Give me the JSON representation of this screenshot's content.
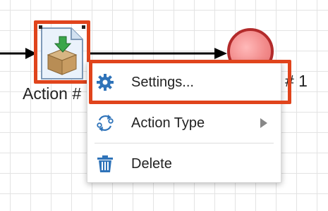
{
  "canvas": {
    "action_node": {
      "label": "Action #",
      "icon": "action-box-icon"
    },
    "end_node": {
      "label": "# 1"
    }
  },
  "context_menu": {
    "items": [
      {
        "label": "Settings...",
        "icon": "gear-icon",
        "highlighted": true
      },
      {
        "label": "Action Type",
        "icon": "action-type-icon",
        "has_submenu": true
      },
      {
        "label": "Delete",
        "icon": "trash-icon"
      }
    ]
  },
  "colors": {
    "highlight": "#e0441c",
    "end_node_fill": "#f28b8b",
    "end_node_border": "#b32b2b",
    "icon_blue": "#2f73b9"
  }
}
